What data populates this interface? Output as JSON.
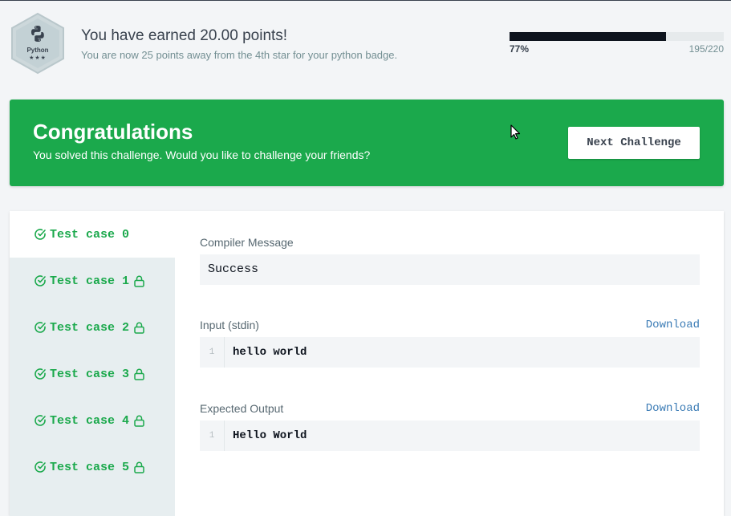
{
  "header": {
    "badge": {
      "label": "Python",
      "stars": "★★★",
      "icon": "python-logo-icon"
    },
    "points_title": "You have earned 20.00 points!",
    "points_subtitle": "You are now 25 points away from the 4th star for your python badge.",
    "progress": {
      "fraction": 0.77,
      "percent_label": "77%",
      "count_label": "195/220"
    }
  },
  "congrats": {
    "title": "Congratulations",
    "subtitle": "You solved this challenge. Would you like to challenge your friends?",
    "next_button": "Next Challenge"
  },
  "results": {
    "tabs": [
      {
        "label": "Test case 0",
        "active": true,
        "locked": false
      },
      {
        "label": "Test case 1",
        "active": false,
        "locked": true
      },
      {
        "label": "Test case 2",
        "active": false,
        "locked": true
      },
      {
        "label": "Test case 3",
        "active": false,
        "locked": true
      },
      {
        "label": "Test case 4",
        "active": false,
        "locked": true
      },
      {
        "label": "Test case 5",
        "active": false,
        "locked": true
      }
    ],
    "compiler_message_label": "Compiler Message",
    "compiler_message": "Success",
    "input_label": "Input (stdin)",
    "input_download": "Download",
    "input_line_number": "1",
    "input_text": "hello world",
    "expected_label": "Expected Output",
    "expected_download": "Download",
    "expected_line_number": "1",
    "expected_text": "Hello World"
  },
  "colors": {
    "success_green": "#1ba94c",
    "dark": "#0e141e",
    "link_blue": "#3a7bb5"
  }
}
